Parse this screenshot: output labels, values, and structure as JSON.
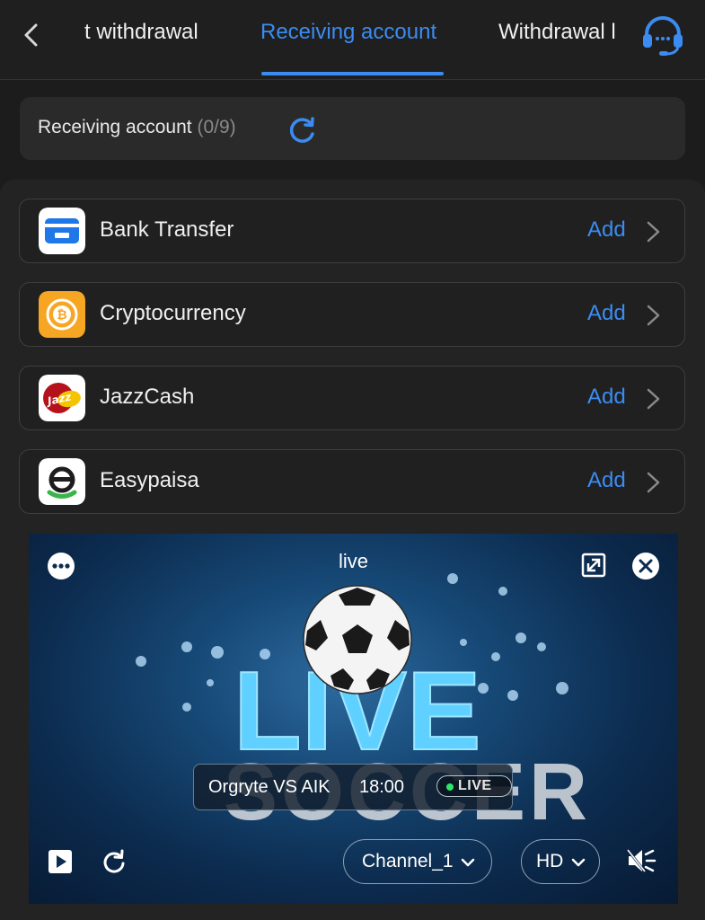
{
  "header": {
    "tabs": [
      {
        "label": "t withdrawal"
      },
      {
        "label": "Receiving account"
      },
      {
        "label": "Withdrawal l"
      }
    ],
    "active_tab": 1,
    "icons": {
      "back": "chevron-left-icon",
      "support": "headset-icon"
    }
  },
  "summary": {
    "label": "Receiving account",
    "count": "(0/9)",
    "icon": "refresh-icon"
  },
  "methods": [
    {
      "name": "Bank Transfer",
      "action": "Add",
      "icon": "bank-card-icon"
    },
    {
      "name": "Cryptocurrency",
      "action": "Add",
      "icon": "bitcoin-icon"
    },
    {
      "name": "JazzCash",
      "action": "Add",
      "icon": "jazzcash-logo"
    },
    {
      "name": "Easypaisa",
      "action": "Add",
      "icon": "easypaisa-logo"
    }
  ],
  "player": {
    "title": "live",
    "art_logo": "LIVE SOCCER",
    "match": {
      "teams": "Orgryte VS AIK",
      "time": "18:00",
      "badge": "LIVE"
    },
    "channel": "Channel_1",
    "quality": "HD",
    "icons": [
      "more-icon",
      "expand-icon",
      "close-icon",
      "play-icon",
      "replay-icon",
      "mute-icon"
    ]
  },
  "colors": {
    "accent": "#3b8cf2",
    "background": "#1c1c1c",
    "card": "#2a2a2a",
    "live_dot": "#2ee66a",
    "crypto": "#f6a623"
  }
}
